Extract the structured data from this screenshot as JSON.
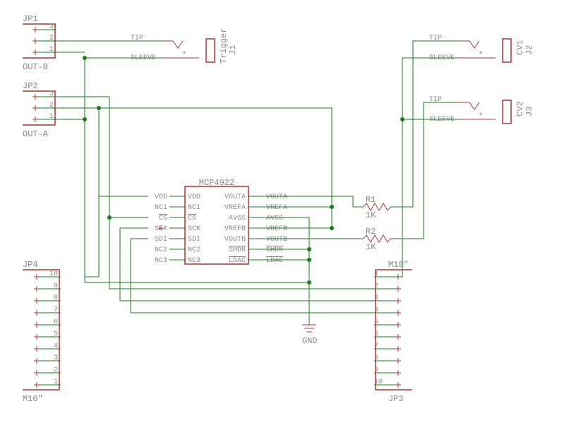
{
  "ic": {
    "name": "MCP4922",
    "left_labels": [
      "VDD",
      "NC1",
      "CS",
      "SCK",
      "SDI",
      "NC2",
      "NC3"
    ],
    "right_labels": [
      "VOUTA",
      "VREFA",
      "AVSS",
      "VREFB",
      "VOUTB",
      "SHDN",
      "LDAC"
    ],
    "left_nets": [
      "VDD",
      "NC1",
      "CS",
      "SCK",
      "SDI",
      "NC2",
      "NC3"
    ],
    "right_nets": [
      "VOUTA",
      "VREFA",
      "AVSS",
      "VREFB",
      "VOUTB",
      "SHDN",
      "LDAC"
    ],
    "strike": "E"
  },
  "jacks": {
    "j1": {
      "name": "Trigger",
      "ref": "J1",
      "tip": "TIP",
      "sleeve": "SLEEVE"
    },
    "j2": {
      "name": "CV1",
      "ref": "J2",
      "tip": "TIP",
      "sleeve": "SLEEVE"
    },
    "j3": {
      "name": "CV2",
      "ref": "J3",
      "tip": "TIP",
      "sleeve": "SLEEVE"
    }
  },
  "headers": {
    "jp1": {
      "ref": "JP1",
      "value": "OUT-B",
      "pins": [
        "1",
        "2",
        "3"
      ]
    },
    "jp2": {
      "ref": "JP2",
      "value": "OUT-A",
      "pins": [
        "1",
        "2",
        "3"
      ]
    },
    "jp3": {
      "ref": "JP3",
      "value": "M10\"",
      "pins": [
        "1",
        "2",
        "3",
        "4",
        "5",
        "6",
        "7",
        "8",
        "9",
        "10"
      ]
    },
    "jp4": {
      "ref": "JP4",
      "value": "M10\"",
      "pins": [
        "1",
        "2",
        "3",
        "4",
        "5",
        "6",
        "7",
        "8",
        "9",
        "10"
      ]
    }
  },
  "resistors": {
    "r1": {
      "ref": "R1",
      "value": "1K"
    },
    "r2": {
      "ref": "R2",
      "value": "1K"
    }
  },
  "gnd": {
    "label": "GND"
  }
}
